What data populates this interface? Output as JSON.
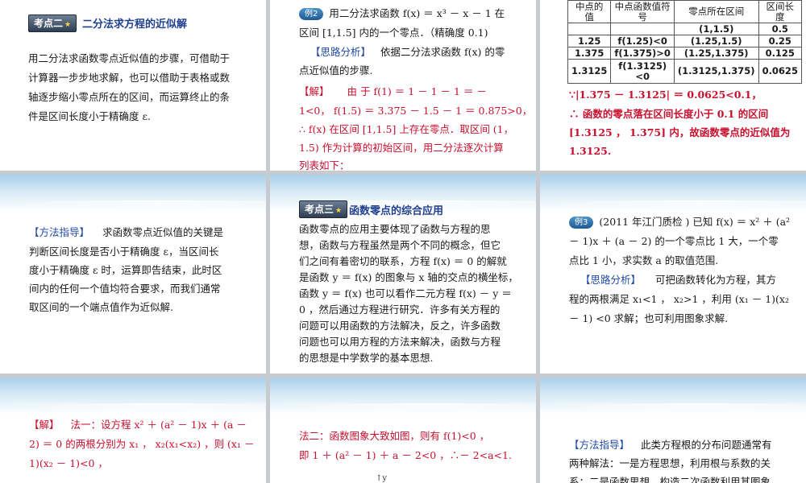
{
  "slide1": {
    "badge": "考点二",
    "title": "二分法求方程的近似解",
    "body": [
      "用二分法求函数零点近似值的步骤，可借助于",
      "计算器一步步地求解，也可以借助于表格或数",
      "轴逐步缩小零点所在的区间，而运算终止的条",
      "件是区间长度小于精确度 ε."
    ]
  },
  "slide2": {
    "example_badge": "例2",
    "lines": [
      "用二分法求函数 f(x) ＝ x³ － x － 1 在",
      "区间 [1,1.5] 内的一个零点．（精确度 0.1)"
    ],
    "analysis_label": "【思路分析】",
    "analysis": [
      "依据二分法求函数 f(x) 的零",
      "点近似值的步骤."
    ],
    "solution_label": "【解】",
    "solution": [
      "由 于 f(1) ＝ 1 － 1 － 1 ＝ －",
      "1<0， f(1.5) ＝ 3.375 － 1.5 － 1 ＝ 0.875>0，",
      "∴ f(x) 在区间 [1,1.5] 上存在零点．取区间 (1，",
      "1.5) 作为计算的初始区间，用二分法逐次计算",
      "列表如下："
    ]
  },
  "slide3": {
    "headers": [
      "中点的值",
      "中点函数值符号",
      "零点所在区间",
      "区间长度"
    ],
    "rows": [
      [
        "",
        "",
        "(1,1.5)",
        "0.5"
      ],
      [
        "1.25",
        "f(1.25)<0",
        "(1.25,1.5)",
        "0.25"
      ],
      [
        "1.375",
        "f(1.375)>0",
        "(1.25,1.375)",
        "0.125"
      ],
      [
        "1.3125",
        "f(1.3125)<0",
        "(1.3125,1.375)",
        "0.0625"
      ]
    ],
    "conclusion": [
      "∵|1.375 － 1.3125| ＝ 0.0625<0.1，",
      "∴ 函数的零点落在区间长度小于 0.1 的区间",
      "[1.3125 ， 1.375] 内，故函数零点的近似值为",
      "1.3125."
    ]
  },
  "slide4": {
    "label": "【方法指导】",
    "lines": [
      "求函数零点近似值的关键是",
      "判断区间长度是否小于精确度 ε，当区间长",
      "度小于精确度 ε 时，运算即告结束，此时区",
      "间内的任何一个值均符合要求，而我们通常",
      "取区间的一个端点值作为近似解."
    ]
  },
  "slide5": {
    "badge": "考点三",
    "title": "函数零点的综合应用",
    "lines": [
      "函数零点的应用主要体现了函数与方程的思",
      "想，函数与方程虽然是两个不同的概念，但它",
      "们之间有着密切的联系，方程 f(x) ＝ 0 的解就",
      "是函数 y ＝ f(x) 的图象与 x 轴的交点的横坐标，",
      "函数 y ＝ f(x) 也可以看作二元方程 f(x) － y ＝",
      "0 ，然后通过方程进行研究．许多有关方程的",
      "问题可以用函数的方法解决，反之，许多函数",
      "问题也可以用方程的方法来解决，函数与方程",
      "的思想是中学数学的基本思想."
    ]
  },
  "slide6": {
    "example_badge": "例3",
    "lines": [
      "(2011 年江门质检 ) 已知 f(x) ＝ x² ＋ (a²",
      "－ 1)x ＋ (a － 2) 的一个零点比 1 大，一个零",
      "点比 1 小，求实数 a 的取值范围."
    ],
    "analysis_label": "【思路分析】",
    "analysis": [
      "可把函数转化为方程，其方",
      "程的两根满足 x₁<1 ， x₂>1 ，利用 (x₁ － 1)(x₂",
      "－ 1) <0 求解；也可利用图象求解."
    ]
  },
  "slide7": {
    "label": "【解】",
    "lines": [
      "法一：设方程 x² ＋ (a² － 1)x ＋ (a －",
      "2) ＝ 0 的两根分别为 x₁ ， x₂(x₁<x₂) ，则 (x₁ －",
      "1)(x₂ － 1)<0 ，"
    ]
  },
  "slide8": {
    "lines": [
      "法二：函数图象大致如图，则有 f(1)<0 ，",
      "即 1 ＋ (a² － 1) ＋ a － 2<0 ，∴－ 2<a<1."
    ],
    "axis": "y"
  },
  "slide9": {
    "label": "【方法指导】",
    "lines": [
      "此类方程根的分布问题通常有",
      "两种解法：一是方程思想，利用根与系数的关",
      "系；二是函数思想，构造二次函数利用其图象"
    ]
  }
}
